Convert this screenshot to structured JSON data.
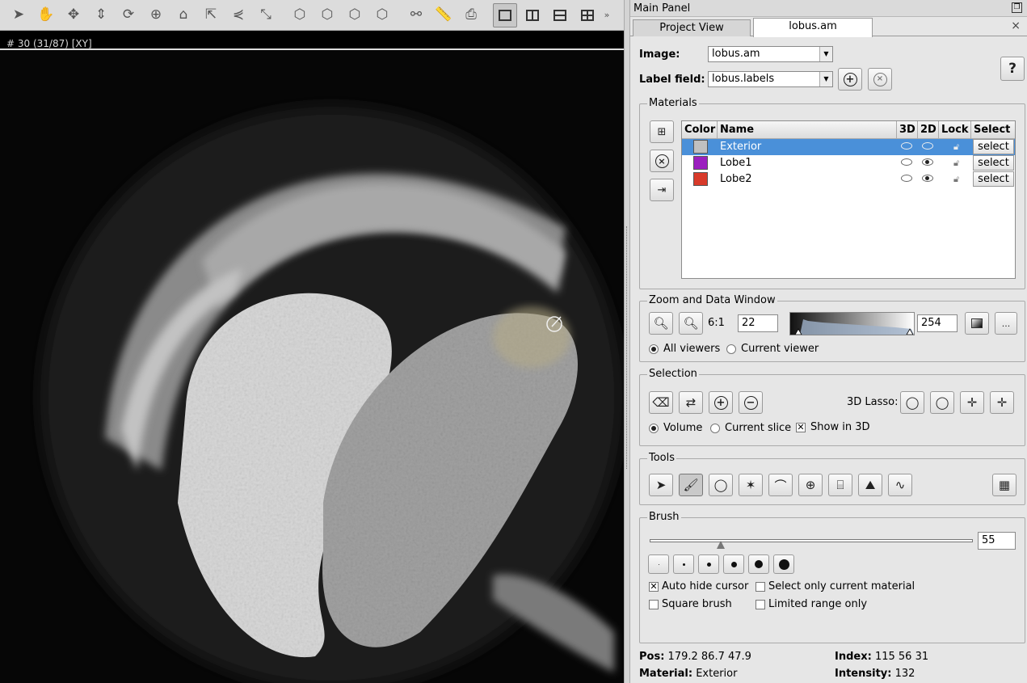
{
  "viewer": {
    "slice_label": "# 30 (31/87) [XY]"
  },
  "panel": {
    "title": "Main Panel",
    "tabs": [
      {
        "label": "Project View"
      },
      {
        "label": "lobus.am"
      }
    ],
    "close_glyph": "×"
  },
  "image_row": {
    "label": "Image:",
    "value": "lobus.am"
  },
  "label_field_row": {
    "label": "Label field:",
    "value": "lobus.labels"
  },
  "help_label": "?",
  "materials": {
    "title": "Materials",
    "columns": [
      "Color",
      "Name",
      "3D",
      "2D",
      "Lock",
      "Select"
    ],
    "rows": [
      {
        "color": "#c0c0c0",
        "name": "Exterior",
        "select": "select",
        "selected": true
      },
      {
        "color": "#9b1fbf",
        "name": "Lobe1",
        "select": "select",
        "selected": false
      },
      {
        "color": "#d83a2a",
        "name": "Lobe2",
        "select": "select",
        "selected": false
      }
    ]
  },
  "zoom": {
    "title": "Zoom and Data Window",
    "ratio": "6:1",
    "min": "22",
    "max": "254",
    "more_label": "...",
    "radio_all": "All viewers",
    "radio_current": "Current viewer"
  },
  "selection": {
    "title": "Selection",
    "lasso_label": "3D Lasso:",
    "radio_volume": "Volume",
    "radio_slice": "Current slice",
    "check_show3d": "Show in 3D"
  },
  "tools": {
    "title": "Tools"
  },
  "brush": {
    "title": "Brush",
    "size": "55",
    "size_fraction": 0.22,
    "auto_hide": "Auto hide cursor",
    "only_current": "Select only current material",
    "square": "Square brush",
    "limited": "Limited range only"
  },
  "status": {
    "pos_label": "Pos:",
    "pos_value": "179.2 86.7 47.9",
    "index_label": "Index:",
    "index_value": "115 56 31",
    "material_label": "Material:",
    "material_value": "Exterior",
    "intensity_label": "Intensity:",
    "intensity_value": "132"
  },
  "colors": {
    "selection_blue": "#4a90d9",
    "panel_bg": "#e6e6e6"
  }
}
